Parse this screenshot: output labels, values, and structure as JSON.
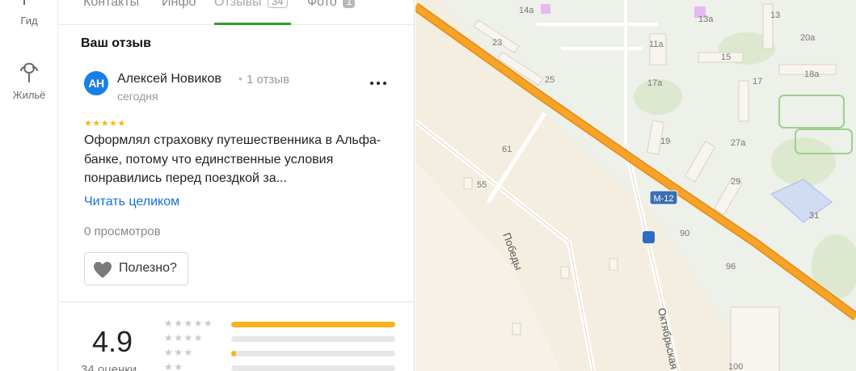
{
  "rail": {
    "items": [
      {
        "label": "Гид",
        "icon": "guide-icon"
      },
      {
        "label": "Жильё",
        "icon": "housing-icon"
      }
    ]
  },
  "tabs": [
    {
      "label": "Контакты",
      "badge": ""
    },
    {
      "label": "Инфо",
      "badge": ""
    },
    {
      "label": "Отзывы",
      "badge": "34",
      "active": true
    },
    {
      "label": "Фото",
      "badge": "1"
    }
  ],
  "review": {
    "section_title": "Ваш отзыв",
    "avatar_initials": "АН",
    "author": "Алексей Новиков",
    "separator": "•",
    "author_reviews": "1 отзыв",
    "date": "сегодня",
    "stars": "★★★★★",
    "rating": 5,
    "text": "Оформлял страховку путешественника в Альфа-банке, потому что единственные условия понравились перед поездкой за...",
    "read_more": "Читать целиком",
    "views": "0 просмотров",
    "useful_label": "Полезно?"
  },
  "summary": {
    "rating": "4.9",
    "ratings_count": "34 оценки",
    "distribution": [
      {
        "stars": "★★★★★",
        "fraction": 1.0
      },
      {
        "stars": "★★★★",
        "fraction": 0.0
      },
      {
        "stars": "★★★",
        "fraction": 0.03
      },
      {
        "stars": "★★",
        "fraction": 0.0
      }
    ]
  },
  "colors": {
    "accent_green": "#2f9f2c",
    "link_blue": "#1a6ed8",
    "star_yellow": "#f5b80c",
    "highway_orange": "#f29a1c"
  },
  "map": {
    "highway_label": "М-12",
    "street_labels": [
      "Победы",
      "Октябрьская"
    ],
    "house_numbers": [
      "14а",
      "13а",
      "13",
      "20а",
      "23",
      "11а",
      "15",
      "25",
      "17а",
      "17",
      "18а",
      "61",
      "19",
      "27а",
      "55",
      "29",
      "31",
      "90",
      "96",
      "100"
    ]
  }
}
